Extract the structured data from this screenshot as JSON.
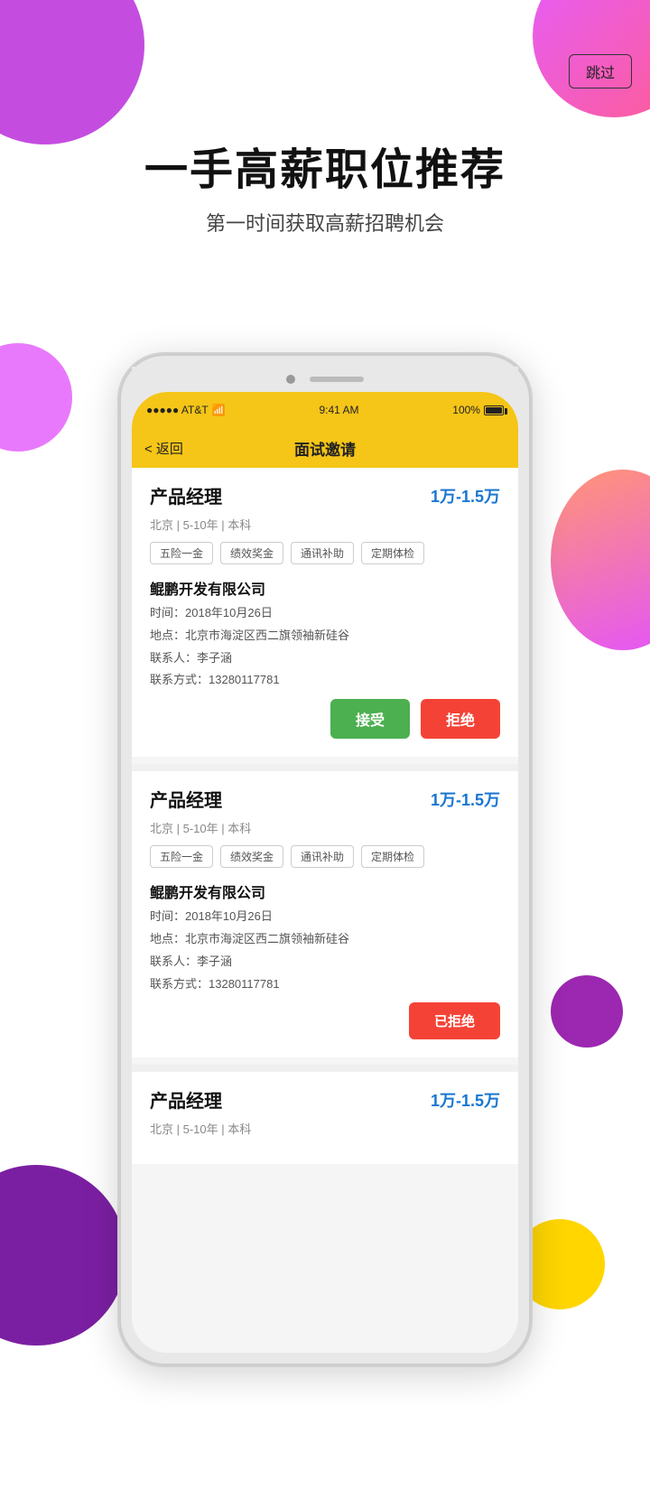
{
  "skip_button": "跳过",
  "hero": {
    "title": "一手高薪职位推荐",
    "subtitle": "第一时间获取高薪招聘机会"
  },
  "phone": {
    "status_bar": {
      "carrier": "●●●●● AT&T",
      "wifi": "WiFi",
      "time": "9:41 AM",
      "battery": "100%"
    },
    "nav": {
      "back": "< 返回",
      "title": "面试邀请"
    },
    "jobs": [
      {
        "title": "产品经理",
        "salary": "1万-1.5万",
        "meta": "北京 | 5-10年 | 本科",
        "tags": [
          "五险一金",
          "绩效奖金",
          "通讯补助",
          "定期体检"
        ],
        "company": "鲲鹏开发有限公司",
        "time": "时间：2018年10月26日",
        "location": "地点：北京市海淀区西二旗领袖新硅谷",
        "contact": "联系人：李子涵",
        "phone": "联系方式：13280117781",
        "status": "pending",
        "btn_accept": "接受",
        "btn_reject": "拒绝"
      },
      {
        "title": "产品经理",
        "salary": "1万-1.5万",
        "meta": "北京 | 5-10年 | 本科",
        "tags": [
          "五险一金",
          "绩效奖金",
          "通讯补助",
          "定期体检"
        ],
        "company": "鲲鹏开发有限公司",
        "time": "时间：2018年10月26日",
        "location": "地点：北京市海淀区西二旗领袖新硅谷",
        "contact": "联系人：李子涵",
        "phone": "联系方式：13280117781",
        "status": "rejected",
        "btn_rejected": "已拒绝"
      },
      {
        "title": "产品经理",
        "salary": "1万-1.5万",
        "meta": "北京 | 5-10年 | 本科",
        "tags": [],
        "company": "",
        "time": "",
        "location": "",
        "contact": "",
        "phone": "",
        "status": "partial"
      }
    ]
  }
}
